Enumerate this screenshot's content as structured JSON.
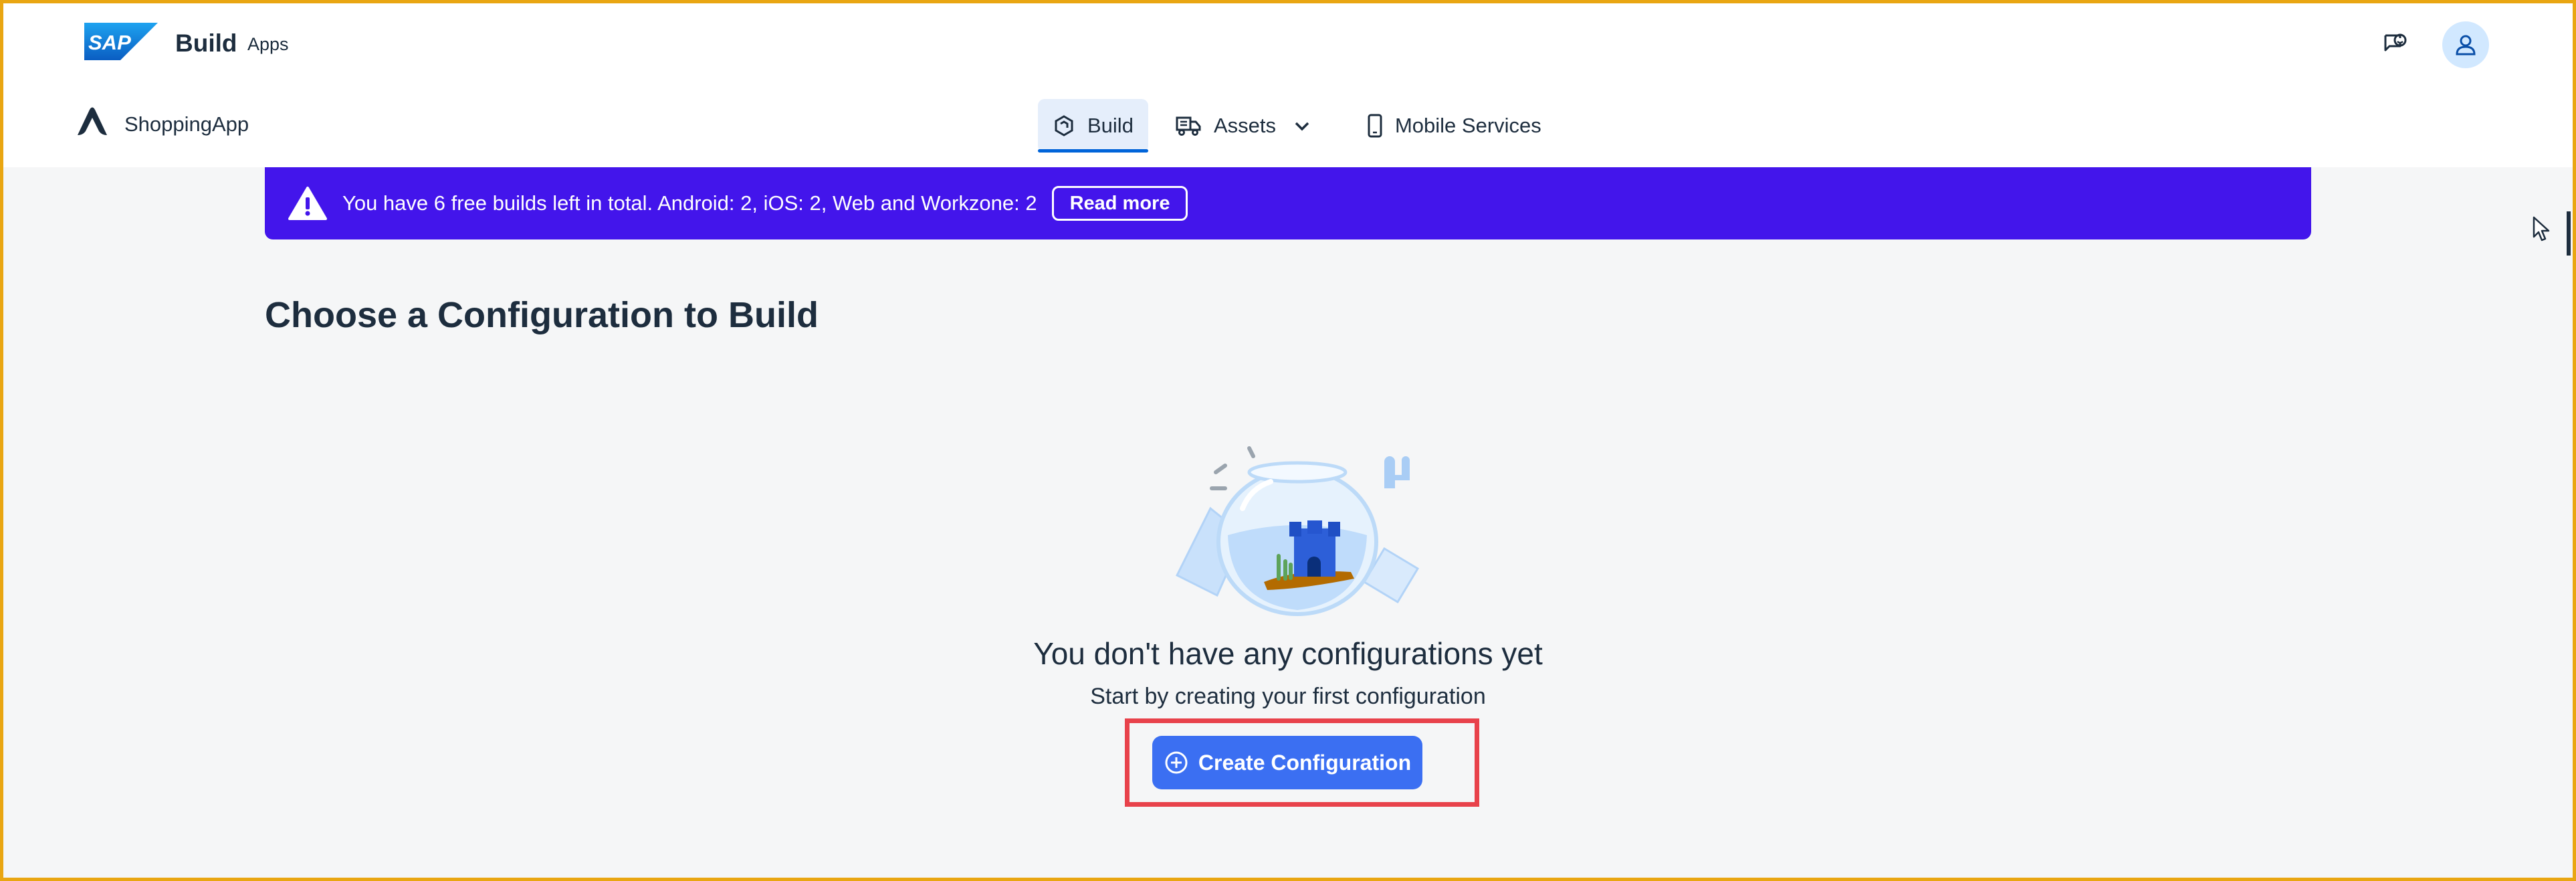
{
  "shellbar": {
    "logo_text": "SAP",
    "title": "Build",
    "subtitle": "Apps",
    "feedback_icon": "feedback-icon",
    "avatar_icon": "user-icon"
  },
  "subheader": {
    "app_name": "ShoppingApp",
    "tabs": [
      {
        "label": "Build",
        "icon": "build-icon",
        "active": true
      },
      {
        "label": "Assets",
        "icon": "assets-icon",
        "active": false,
        "has_dropdown": true
      },
      {
        "label": "Mobile Services",
        "icon": "mobile-icon",
        "active": false
      }
    ]
  },
  "banner": {
    "message": "You have 6 free builds left in total. Android: 2, iOS: 2, Web and Workzone: 2",
    "button_label": "Read more",
    "icon": "warning-icon",
    "color": "#4315eb"
  },
  "main": {
    "title": "Choose a Configuration to Build",
    "empty_state": {
      "title": "You don't have any configurations yet",
      "subtitle": "Start by creating your first configuration",
      "button_label": "Create Configuration",
      "button_icon": "add-circle-icon"
    }
  },
  "colors": {
    "accent": "#3b6ff2",
    "highlight": "#e8424b",
    "frame": "#e9a612",
    "background": "#f5f6f7"
  }
}
